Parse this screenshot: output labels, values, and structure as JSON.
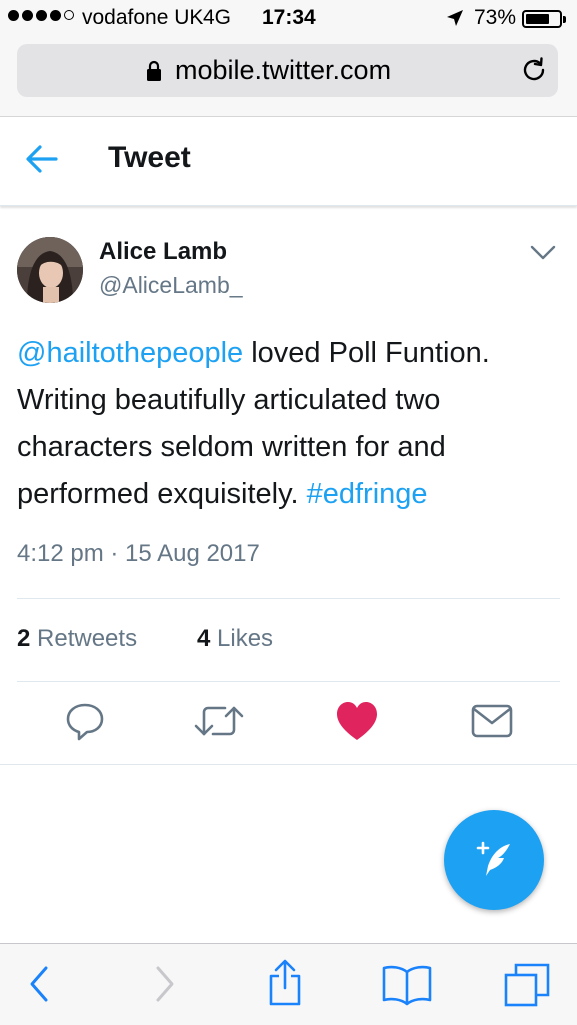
{
  "status_bar": {
    "carrier": "vodafone UK",
    "network": "4G",
    "time": "17:34",
    "battery": "73%",
    "battery_level": 0.73
  },
  "browser": {
    "url": "mobile.twitter.com"
  },
  "header": {
    "title": "Tweet"
  },
  "tweet": {
    "author_name": "Alice Lamb",
    "author_handle": "@AliceLamb_",
    "text_mention": "@hailtothepeople",
    "text_body": " loved Poll Funtion. Writing beautifully articulated two characters seldom written for and performed exquisitely. ",
    "text_hashtag": "#edfringe",
    "timestamp": "4:12 pm · 15 Aug 2017",
    "retweets_count": "2",
    "retweets_label": "Retweets",
    "likes_count": "4",
    "likes_label": "Likes",
    "liked": true
  },
  "colors": {
    "twitter_blue": "#1da1f2",
    "like_red": "#e0245e",
    "secondary_text": "#657786",
    "ios_blue": "#1a82fb"
  },
  "icons": {
    "back": "arrow-left-icon",
    "caret": "chevron-down-icon",
    "reply": "reply-icon",
    "retweet": "retweet-icon",
    "like": "heart-icon",
    "dm": "envelope-icon",
    "compose": "compose-tweet-icon"
  }
}
